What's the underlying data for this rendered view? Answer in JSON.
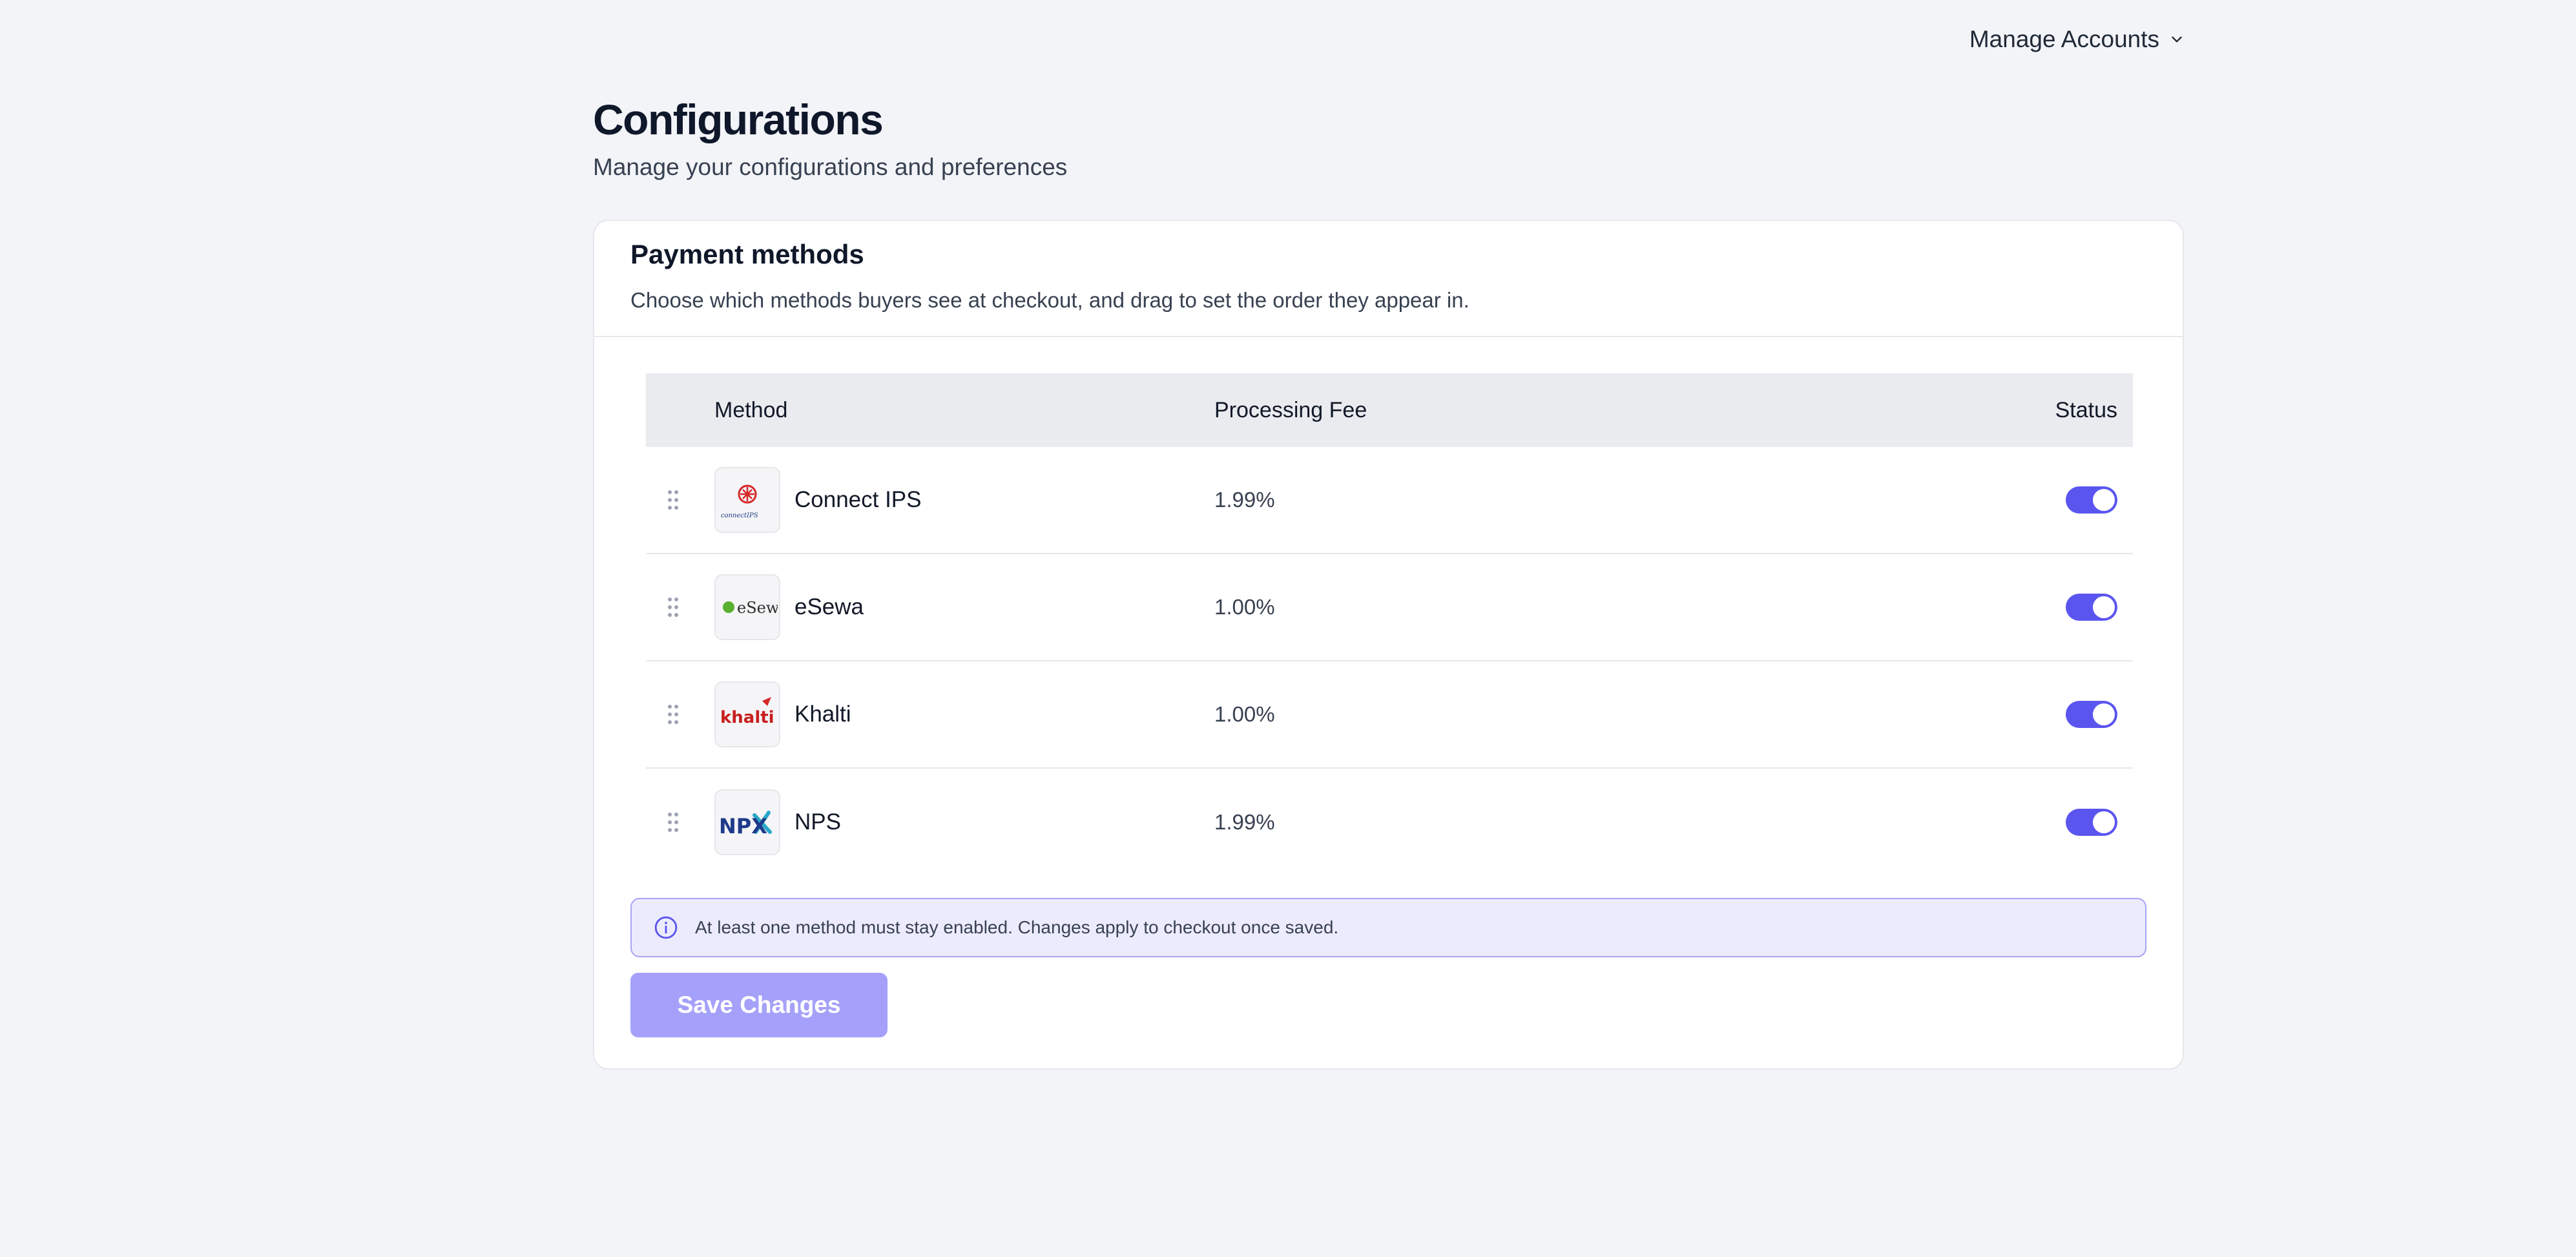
{
  "header": {
    "account_menu_label": "Manage Accounts",
    "account_menu_icon": "chevron-down-icon"
  },
  "page": {
    "title": "Configurations",
    "subtitle": "Manage your configurations and preferences"
  },
  "payment_methods": {
    "title": "Payment methods",
    "description": "Choose which methods buyers see at checkout, and drag to set the order they appear in.",
    "columns": {
      "method": "Method",
      "fee": "Processing Fee",
      "status": "Status"
    },
    "rows": [
      {
        "name": "Connect IPS",
        "fee": "1.99%",
        "enabled": true,
        "logo_text": "connectIPS"
      },
      {
        "name": "eSewa",
        "fee": "1.00%",
        "enabled": true,
        "logo_text": "eSewa"
      },
      {
        "name": "Khalti",
        "fee": "1.00%",
        "enabled": true,
        "logo_text": "khalti"
      },
      {
        "name": "NPS",
        "fee": "1.99%",
        "enabled": true,
        "logo_text": "NPX"
      }
    ],
    "notice": "At least one method must stay enabled. Changes apply to checkout once saved.",
    "save_label": "Save Changes"
  },
  "colors": {
    "accent": "#5b55f0",
    "save_button_disabled": "#a5a1fa",
    "notice_bg": "#ecebfd",
    "page_bg": "#f3f4f8"
  }
}
